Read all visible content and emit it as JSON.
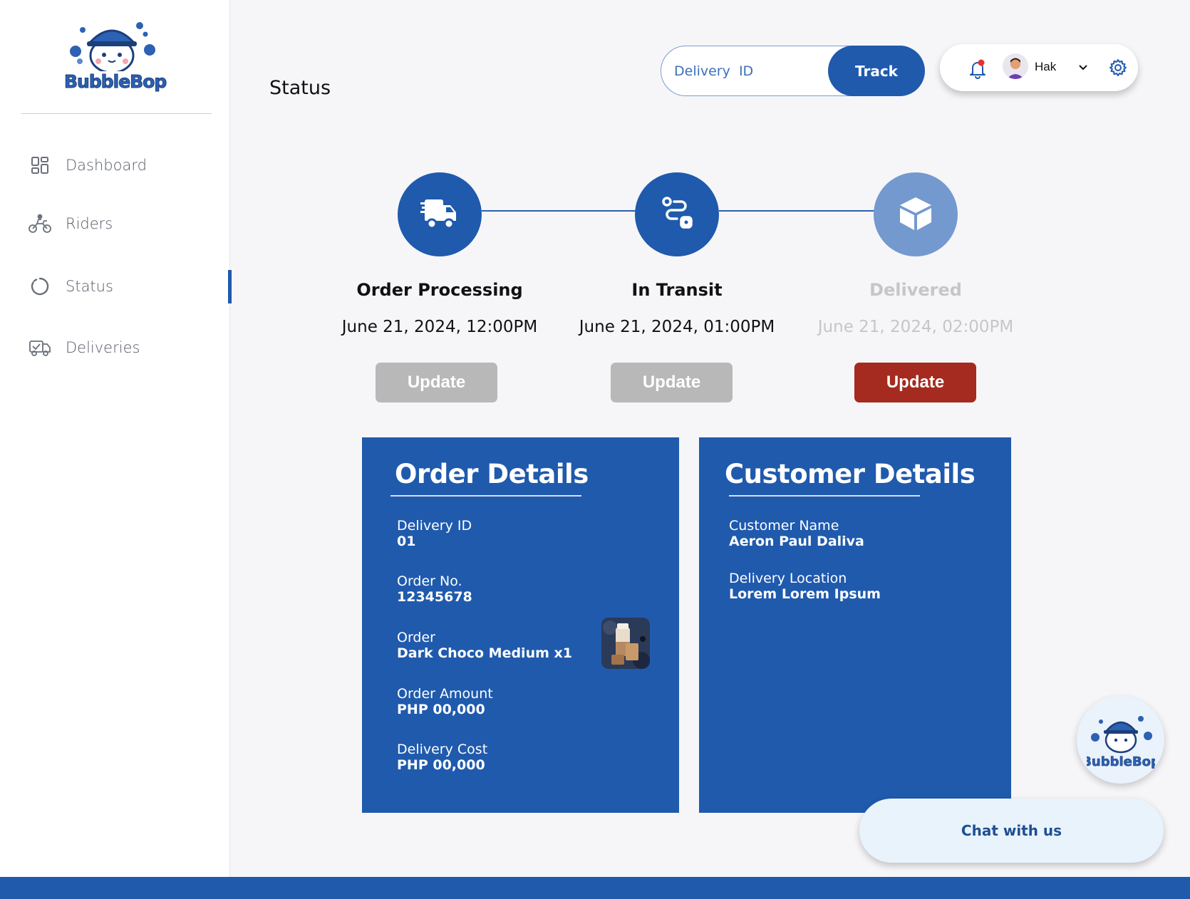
{
  "brand": {
    "name": "BubbleBop"
  },
  "sidebar": {
    "items": [
      {
        "label": "Dashboard",
        "icon": "dashboard-grid-icon"
      },
      {
        "label": "Riders",
        "icon": "motorbike-rider-icon"
      },
      {
        "label": "Status",
        "icon": "status-circle-icon",
        "active": true
      },
      {
        "label": "Deliveries",
        "icon": "delivery-truck-check-icon"
      }
    ]
  },
  "header": {
    "title": "Status",
    "track": {
      "placeholder": "Delivery  ID",
      "value": "",
      "button_label": "Track"
    },
    "user": {
      "name": "Hak"
    }
  },
  "steps": [
    {
      "title": "Order Processing",
      "date": "June 21, 2024, 12:00PM",
      "button": "Update",
      "state": "done",
      "icon": "delivery-truck-icon"
    },
    {
      "title": "In Transit",
      "date": "June 21, 2024, 01:00PM",
      "button": "Update",
      "state": "done",
      "icon": "route-icon"
    },
    {
      "title": "Delivered",
      "date": "June 21, 2024, 02:00PM",
      "button": "Update",
      "state": "pending",
      "icon": "package-box-icon"
    }
  ],
  "order_details": {
    "title": "Order Details",
    "fields": [
      {
        "label": "Delivery ID",
        "value": "01"
      },
      {
        "label": "Order No.",
        "value": "12345678"
      },
      {
        "label": "Order",
        "value": "Dark Choco Medium x1"
      },
      {
        "label": "Order Amount",
        "value": "PHP 00,000"
      },
      {
        "label": "Delivery Cost",
        "value": "PHP 00,000"
      }
    ]
  },
  "customer_details": {
    "title": "Customer Details",
    "fields": [
      {
        "label": "Customer Name",
        "value": "Aeron Paul Daliva"
      },
      {
        "label": "Delivery Location",
        "value": "Lorem Lorem Ipsum"
      }
    ]
  },
  "chat": {
    "label": "Chat with us"
  },
  "colors": {
    "primary": "#1f5aad",
    "pending_step": "#7499cf",
    "update_disabled": "#b8b8b8",
    "update_active": "#a52a1f",
    "muted_text": "#c6c6c6",
    "notification_dot": "#e8322b"
  }
}
